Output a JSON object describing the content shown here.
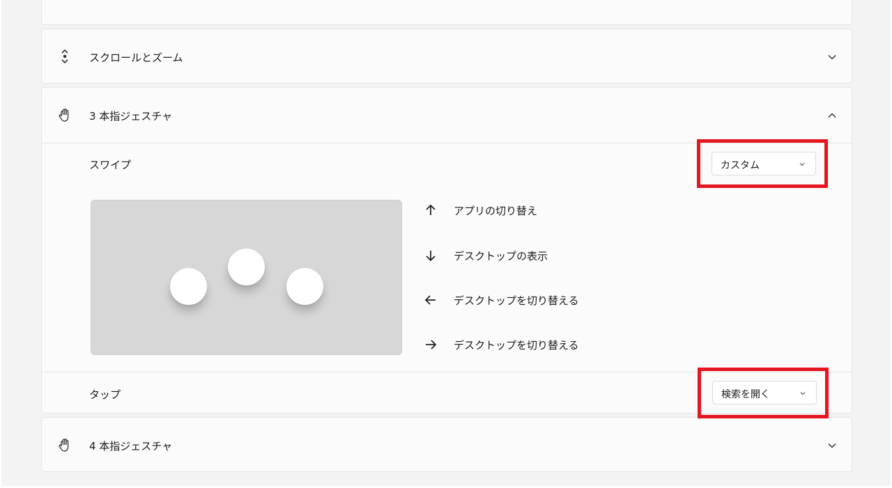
{
  "sections": {
    "scroll_zoom": {
      "title": "スクロールとズーム",
      "icon": "scroll-icon"
    },
    "three_finger": {
      "title": "3 本指ジェスチャ",
      "icon": "hand-icon"
    },
    "four_finger": {
      "title": "4 本指ジェスチャ",
      "icon": "hand-icon"
    }
  },
  "three_finger": {
    "swipe": {
      "label": "スワイプ",
      "selected": "カスタム",
      "actions": [
        {
          "direction": "up",
          "icon": "arrow-up-icon",
          "label": "アプリの切り替え"
        },
        {
          "direction": "down",
          "icon": "arrow-down-icon",
          "label": "デスクトップの表示"
        },
        {
          "direction": "left",
          "icon": "arrow-left-icon",
          "label": "デスクトップを切り替える"
        },
        {
          "direction": "right",
          "icon": "arrow-right-icon",
          "label": "デスクトップを切り替える"
        }
      ]
    },
    "tap": {
      "label": "タップ",
      "selected": "検索を開く"
    }
  },
  "highlight_color": "#e41620"
}
